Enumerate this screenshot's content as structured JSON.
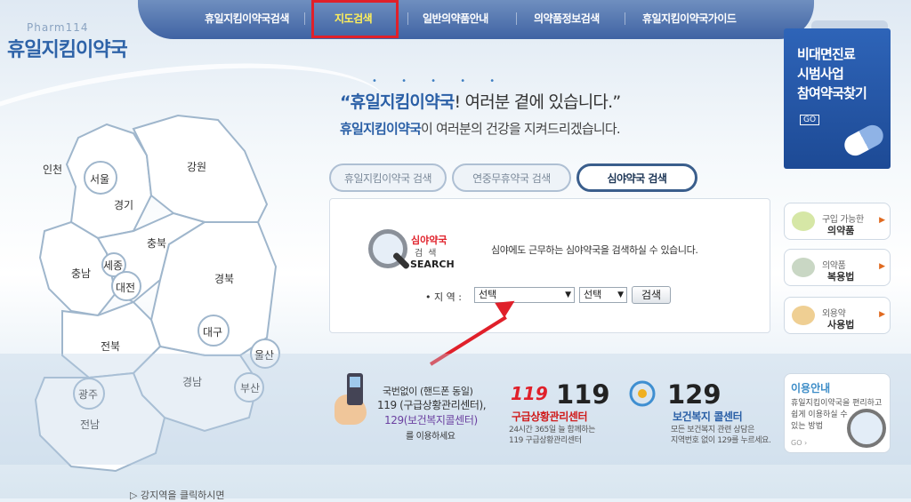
{
  "logo": {
    "small": "Pharm114",
    "main": "휴일지킴이약국"
  },
  "nav": {
    "items": [
      {
        "label": "휴일지킴이약국검색"
      },
      {
        "label": "지도검색"
      },
      {
        "label": "일반의약품안내"
      },
      {
        "label": "의약품정보검색"
      },
      {
        "label": "휴일지킴이약국가이드"
      }
    ],
    "active_index": 1
  },
  "slogan": {
    "dots": "• • • • •",
    "brand": "“휴일지킴이약국",
    "rest": "! 여러분 곁에 있습니다.”"
  },
  "subtitle": {
    "brand": "휴일지킴이약국",
    "rest": "이 여러분의 건강을 지켜드리겠습니다."
  },
  "tabs": [
    {
      "label": "휴일지킴이약국 검색",
      "active": false
    },
    {
      "label": "연중무휴약국 검색",
      "active": false
    },
    {
      "label": "심야약국 검색",
      "active": true
    }
  ],
  "search": {
    "icon_title": "심야약국",
    "icon_sub": "검색",
    "icon_en": "SEARCH",
    "description": "심야에도 근무하는 심야약국을 검색하실 수 있습니다.",
    "region_label": "• 지 역 :",
    "select1_value": "선택",
    "select2_value": "선택",
    "button_label": "검색"
  },
  "map": {
    "regions": [
      "인천",
      "서울",
      "경기",
      "강원",
      "충북",
      "충남",
      "세종",
      "대전",
      "경북",
      "대구",
      "전북",
      "울산",
      "경남",
      "부산",
      "광주",
      "전남"
    ]
  },
  "banner": {
    "text": "비대면진료\n시범사업\n참여약국찾기",
    "go": "GO"
  },
  "side": [
    {
      "line1": "구입 가능한",
      "line2": "의약품",
      "icon": "pill-icon"
    },
    {
      "line1": "의약품",
      "line2": "복용법",
      "icon": "mortar-icon"
    },
    {
      "line1": "외용약",
      "line2": "사용법",
      "icon": "ointment-icon"
    }
  ],
  "bottom": {
    "l1": "국번없이 (핸드폰 동일)",
    "l2": "119 (구급상황관리센터),",
    "l3": "129(보건복지콜센터)",
    "l4": "를 이용하세요",
    "n119_logo": "119",
    "n119": "119",
    "n119_title": "구급상황관리센터",
    "n119_d1": "24시간 365일 늘 함께하는",
    "n119_d2": "119 구급상황관리센터",
    "n129": "129",
    "n129_title": "보건복지 콜센터",
    "n129_d1": "모든 보건복지 관련 상담은",
    "n129_d2": "지역번호 없이 129를 누르세요."
  },
  "info": {
    "title": "이용안내",
    "body": "휴일지킴이약국을 편리하고\n쉽게 이용하실 수\n있는 방법",
    "go": "GO ›"
  },
  "hint": "강지역을 클릭하시면",
  "colors": {
    "nav": "#3f63a3",
    "accent_red": "#e0202a",
    "brand_blue": "#2a5fa6"
  }
}
